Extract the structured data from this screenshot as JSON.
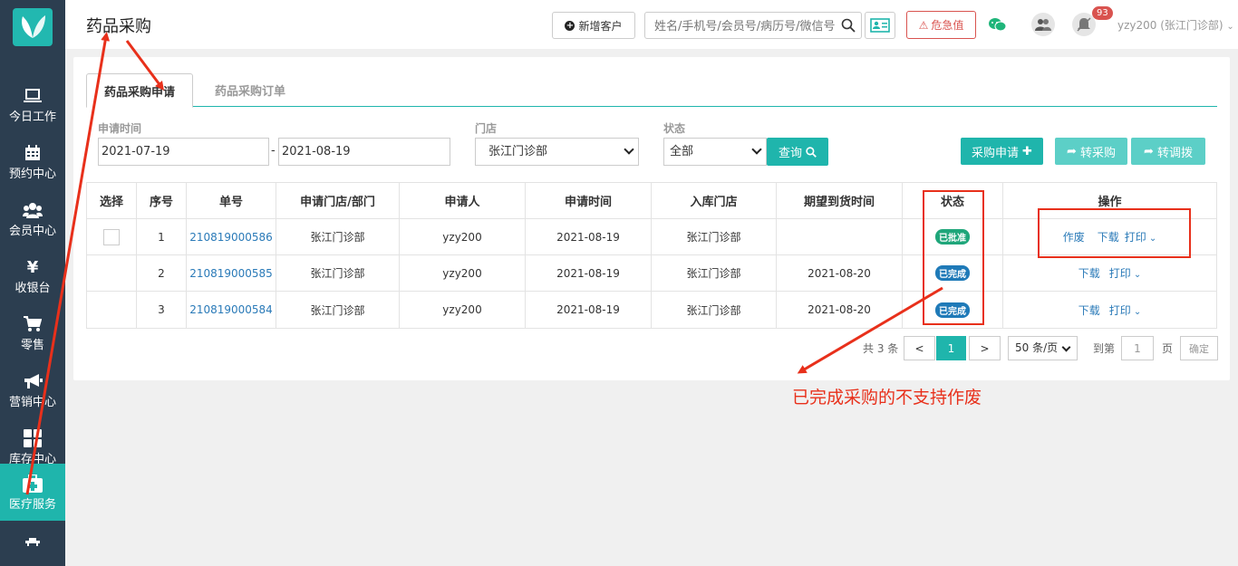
{
  "sidebar": {
    "items": [
      {
        "label": "今日工作",
        "icon": "laptop-icon"
      },
      {
        "label": "预约中心",
        "icon": "calendar-icon"
      },
      {
        "label": "会员中心",
        "icon": "users-icon"
      },
      {
        "label": "收银台",
        "icon": "yen-icon"
      },
      {
        "label": "零售",
        "icon": "cart-icon"
      },
      {
        "label": "营销中心",
        "icon": "megaphone-icon"
      },
      {
        "label": "库存中心",
        "icon": "grid-icon"
      },
      {
        "label": "医疗服务",
        "icon": "medkit-icon"
      }
    ]
  },
  "header": {
    "title": "药品采购",
    "new_customer": "新增客户",
    "search_placeholder": "姓名/手机号/会员号/病历号/微信号",
    "danger_value": "危急值",
    "notification_count": "93",
    "user": "yzy200 (张江门诊部)"
  },
  "tabs": {
    "purchase_request": "药品采购申请",
    "purchase_order": "药品采购订单"
  },
  "filters": {
    "date_label": "申请时间",
    "date_from": "2021-07-19",
    "date_to": "2021-08-19",
    "date_sep": "-",
    "store_label": "门店",
    "store_value": "张江门诊部",
    "status_label": "状态",
    "status_value": "全部",
    "query": "查询"
  },
  "actions": {
    "purchase_request": "采购申请",
    "to_purchase": "转采购",
    "to_transfer": "转调拨"
  },
  "table": {
    "headers": [
      "选择",
      "序号",
      "单号",
      "申请门店/部门",
      "申请人",
      "申请时间",
      "入库门店",
      "期望到货时间",
      "状态",
      "操作"
    ],
    "rows": [
      {
        "seq": "1",
        "no": "210819000586",
        "dept": "张江门诊部",
        "applicant": "yzy200",
        "time": "2021-08-19",
        "store": "张江门诊部",
        "expected": "",
        "status": "已批准",
        "ops": [
          "作废",
          "下载",
          "打印"
        ]
      },
      {
        "seq": "2",
        "no": "210819000585",
        "dept": "张江门诊部",
        "applicant": "yzy200",
        "time": "2021-08-19",
        "store": "张江门诊部",
        "expected": "2021-08-20",
        "status": "已完成",
        "ops": [
          "下载",
          "打印"
        ]
      },
      {
        "seq": "3",
        "no": "210819000584",
        "dept": "张江门诊部",
        "applicant": "yzy200",
        "time": "2021-08-19",
        "store": "张江门诊部",
        "expected": "2021-08-20",
        "status": "已完成",
        "ops": [
          "下载",
          "打印"
        ]
      }
    ]
  },
  "pagination": {
    "total": "共 3 条",
    "prev": "<",
    "current": "1",
    "next": ">",
    "page_size": "50 条/页",
    "goto": "到第",
    "goto_value": "1",
    "page_unit": "页",
    "confirm": "确定"
  },
  "annotation": {
    "note": "已完成采购的不支持作废"
  },
  "colors": {
    "accent": "#1fb5ac",
    "sidebar": "#2c3e50",
    "link": "#2a7ab8",
    "approved": "#1fa67a",
    "completed": "#1f7ab8",
    "annotation": "#e8301b",
    "danger": "#d9534f"
  }
}
